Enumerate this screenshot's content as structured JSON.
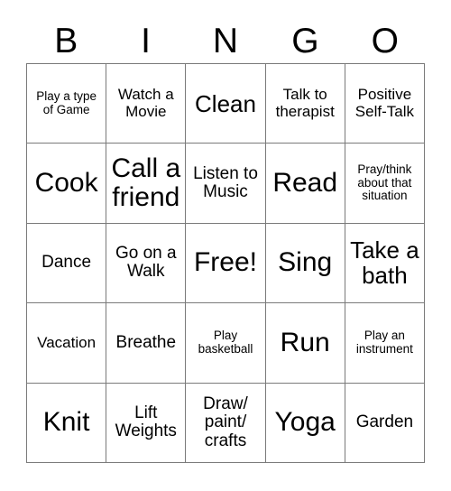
{
  "card": {
    "title_letters": [
      "B",
      "I",
      "N",
      "G",
      "O"
    ],
    "columns": 5,
    "rows": 5,
    "border_color": "#7a7a7a",
    "background_color": "#ffffff",
    "text_color": "#000000",
    "cells": [
      {
        "text": "Play a type of Game",
        "size": "xs"
      },
      {
        "text": "Watch a Movie",
        "size": "sm"
      },
      {
        "text": "Clean",
        "size": "lg"
      },
      {
        "text": "Talk to therapist",
        "size": "sm"
      },
      {
        "text": "Positive Self-Talk",
        "size": "sm"
      },
      {
        "text": "Cook",
        "size": "xl"
      },
      {
        "text": "Call a friend",
        "size": "xl"
      },
      {
        "text": "Listen to Music",
        "size": "md"
      },
      {
        "text": "Read",
        "size": "xl"
      },
      {
        "text": "Pray/think about that situation",
        "size": "xs"
      },
      {
        "text": "Dance",
        "size": "md"
      },
      {
        "text": "Go on a Walk",
        "size": "md"
      },
      {
        "text": "Free!",
        "size": "xl"
      },
      {
        "text": "Sing",
        "size": "xl"
      },
      {
        "text": "Take a bath",
        "size": "lg"
      },
      {
        "text": "Vacation",
        "size": "sm"
      },
      {
        "text": "Breathe",
        "size": "md"
      },
      {
        "text": "Play basketball",
        "size": "xs"
      },
      {
        "text": "Run",
        "size": "xl"
      },
      {
        "text": "Play an instrument",
        "size": "xs"
      },
      {
        "text": "Knit",
        "size": "xl"
      },
      {
        "text": "Lift Weights",
        "size": "md"
      },
      {
        "text": "Draw/ paint/ crafts",
        "size": "md"
      },
      {
        "text": "Yoga",
        "size": "xl"
      },
      {
        "text": "Garden",
        "size": "md"
      }
    ]
  }
}
